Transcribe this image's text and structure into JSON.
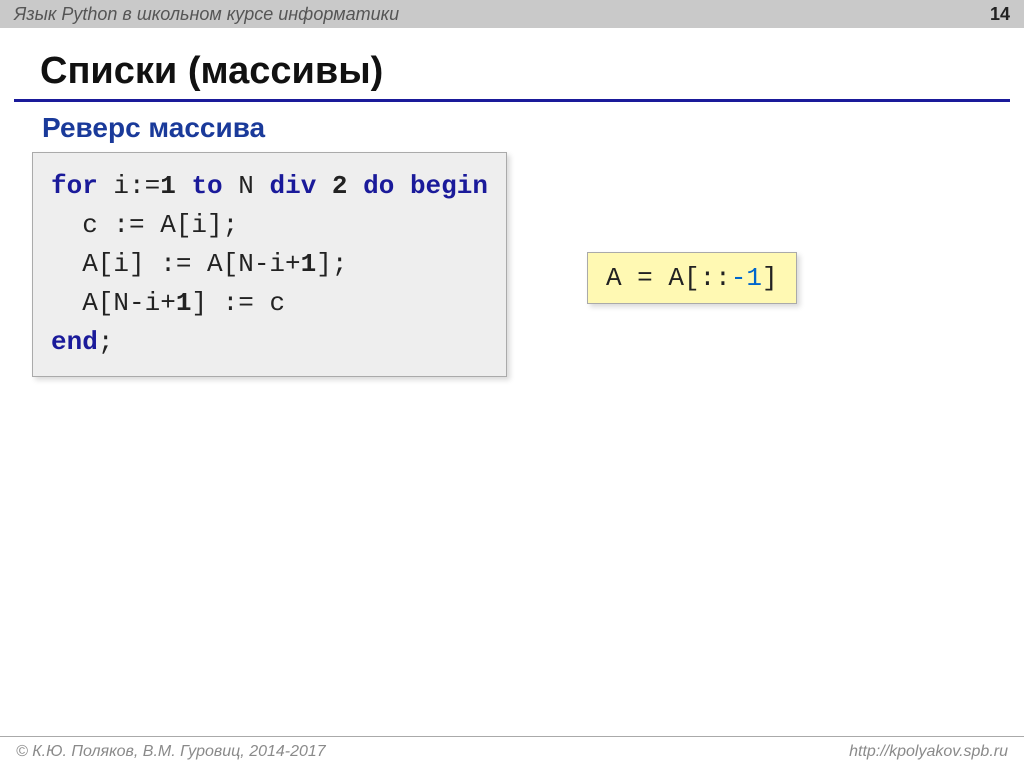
{
  "header": {
    "course_title": "Язык Python в школьном курсе информатики",
    "page_number": "14"
  },
  "title": "Списки (массивы)",
  "subtitle": "Реверс массива",
  "pascal_code": {
    "kw_for": "for",
    "p1": " i:=",
    "n1": "1",
    "p2": " ",
    "kw_to": "to",
    "p3": " N ",
    "kw_div": "div",
    "p4": " ",
    "n2": "2",
    "p5": " ",
    "kw_do": "do",
    "p6": " ",
    "kw_begin": "begin",
    "line2": "  c := A[i];",
    "line3_a": "  A[i] := A[N-i+",
    "line3_n": "1",
    "line3_b": "];",
    "line4_a": "  A[N-i+",
    "line4_n": "1",
    "line4_b": "] := c",
    "kw_end": "end",
    "end_semi": ";"
  },
  "python_code": {
    "pre": "A = A[::",
    "num": "-1",
    "post": "]"
  },
  "footer": {
    "copyright": "© К.Ю. Поляков, В.М. Гуровиц, 2014-2017",
    "url": "http://kpolyakov.spb.ru"
  }
}
